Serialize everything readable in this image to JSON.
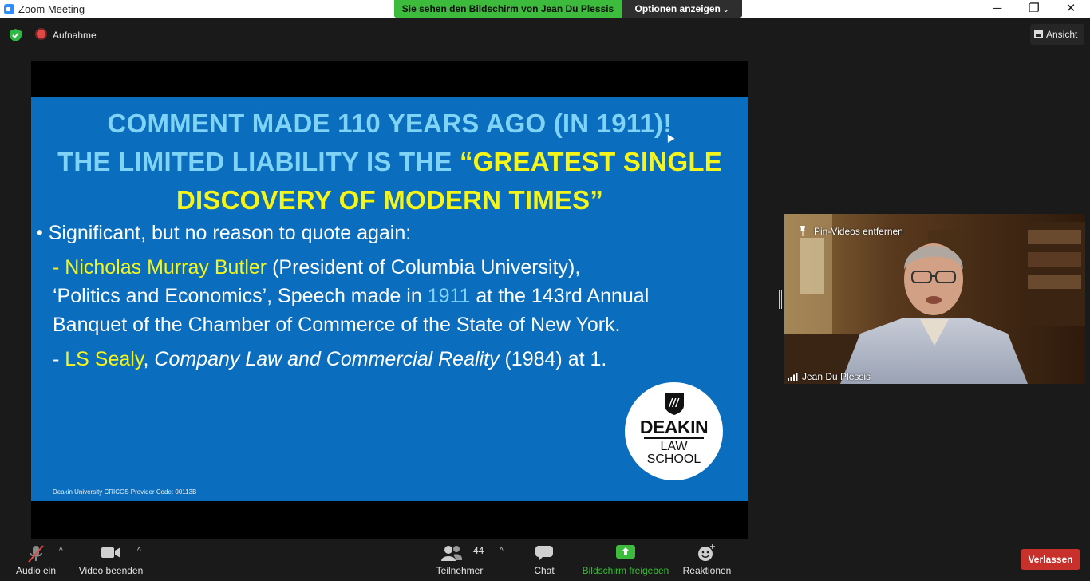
{
  "window": {
    "title": "Zoom Meeting",
    "controls": {
      "minimize": "─",
      "restore": "❐",
      "close": "✕"
    }
  },
  "share_banner": {
    "viewing_text": "Sie sehen den Bildschirm von Jean Du Plessis",
    "options_label": "Optionen anzeigen",
    "options_chevron": "⌄"
  },
  "topbar": {
    "recording_label": "Aufnahme",
    "view_label": "Ansicht",
    "shield_color": "#2fb846",
    "recording_color": "#e04848"
  },
  "slide": {
    "title_line1": "COMMENT MADE 110 YEARS AGO (IN 1911)!",
    "title_line2_prefix": "THE LIMITED LIABILITY IS THE ",
    "title_line2_quote": "“GREATEST SINGLE",
    "title_line3": "DISCOVERY OF MODERN TIMES”",
    "bullet_symbol": "•",
    "bullet_text": "Significant, but no reason to quote again:",
    "ref1_name": "- Nicholas Murray Butler",
    "ref1_detail": " (President of Columbia University),",
    "ref1_line2_a": "‘Politics and Economics’, Speech made in ",
    "ref1_line2_year": "1911",
    "ref1_line2_b": " at the 143rd Annual",
    "ref1_line3": "Banquet of the Chamber of Commerce of the State of New York.",
    "ref2_dash": "- ",
    "ref2_name": "LS Sealy",
    "ref2_comma": ", ",
    "ref2_work": "Company Law and Commercial Reality",
    "ref2_rest": " (1984) at 1.",
    "logo_line1": "DEAKIN",
    "logo_line2": "LAW",
    "logo_line3": "SCHOOL",
    "cricos": "Deakin University CRICOS Provider Code: 00113B",
    "background_color": "#0a6dbd",
    "highlight_color": "#f5f51a",
    "title_color": "#7fd3f5"
  },
  "video": {
    "participant_name": "Jean Du Plessis",
    "pin_label": "Pin-Videos entfernen"
  },
  "toolbar": {
    "audio_label": "Audio ein",
    "video_label": "Video beenden",
    "participants_label": "Teilnehmer",
    "participants_count": "44",
    "chat_label": "Chat",
    "share_label": "Bildschirm freigeben",
    "reactions_label": "Reaktionen",
    "leave_label": "Verlassen",
    "caret": "^",
    "share_color": "#3dbb3d",
    "leave_color": "#c8312b"
  }
}
